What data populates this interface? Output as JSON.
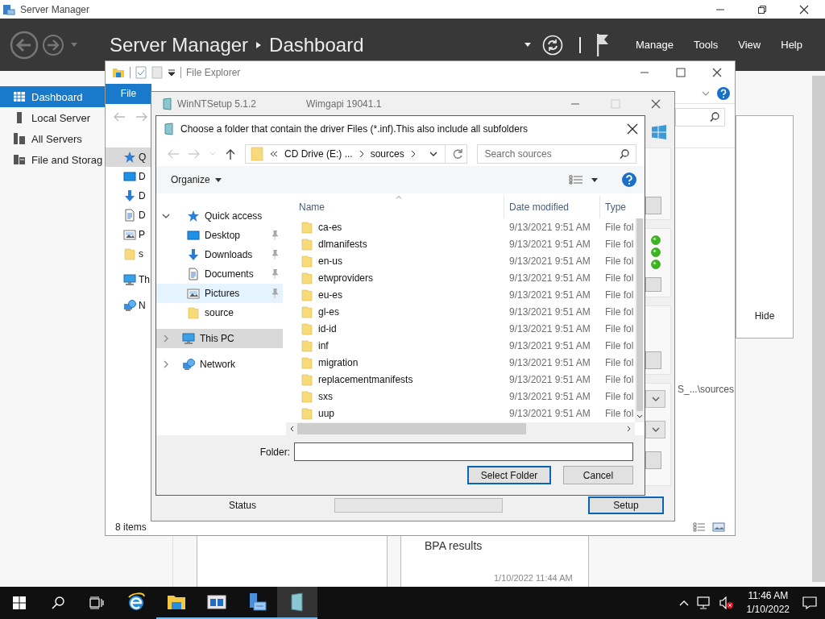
{
  "server_manager": {
    "title": "Server Manager",
    "breadcrumb": [
      "Server Manager",
      "Dashboard"
    ],
    "menu": [
      "Manage",
      "Tools",
      "View",
      "Help"
    ],
    "sidebar": [
      {
        "label": "Dashboard",
        "kind": "dashboard",
        "selected": true
      },
      {
        "label": "Local Server",
        "kind": "server",
        "selected": false
      },
      {
        "label": "All Servers",
        "kind": "servers",
        "selected": false
      },
      {
        "label": "File and Storag",
        "kind": "storage",
        "selected": false
      }
    ],
    "hide_label": "Hide",
    "tile_title": "BPA results",
    "timestamp": "1/10/2022 11:44 AM"
  },
  "file_explorer": {
    "title": "File Explorer",
    "ribbon_tab": "File",
    "nav_items": [
      {
        "label": "Q",
        "kind": "quick",
        "selected": true
      },
      {
        "label": "D",
        "kind": "desktop",
        "selected": false
      },
      {
        "label": "D",
        "kind": "downloads",
        "selected": false
      },
      {
        "label": "D",
        "kind": "documents",
        "selected": false
      },
      {
        "label": "P",
        "kind": "pictures",
        "selected": false
      },
      {
        "label": "s",
        "kind": "folder",
        "selected": false
      },
      {
        "label": "Th",
        "kind": "pc",
        "selected": false
      },
      {
        "label": "N",
        "kind": "network",
        "selected": false
      }
    ],
    "path": "S_...\\sources",
    "status": "8 items"
  },
  "winntsetup": {
    "title": "WinNTSetup 5.1.2",
    "version": "Wimgapi 19041.1",
    "status_label": "Status",
    "progress": {
      "level": 0
    },
    "setup_button": "Setup"
  },
  "folder_dialog": {
    "title": "Choose a folder that contain the driver Files (*.inf).This also include all subfolders",
    "address": [
      "CD Drive (E:) ...",
      "sources"
    ],
    "search_placeholder": "Search sources",
    "organize": "Organize",
    "nav": [
      {
        "label": "Quick access",
        "kind": "quick",
        "expanded": true,
        "selected": false,
        "hovered": false,
        "children": [
          {
            "label": "Desktop",
            "kind": "desktop",
            "pinned": true,
            "selected": false,
            "hovered": false
          },
          {
            "label": "Downloads",
            "kind": "downloads",
            "pinned": true,
            "selected": false,
            "hovered": false
          },
          {
            "label": "Documents",
            "kind": "documents",
            "pinned": true,
            "selected": false,
            "hovered": false
          },
          {
            "label": "Pictures",
            "kind": "pictures",
            "pinned": true,
            "selected": false,
            "hovered": true
          },
          {
            "label": "source",
            "kind": "folder",
            "pinned": false,
            "selected": false,
            "hovered": false
          }
        ]
      },
      {
        "label": "This PC",
        "kind": "pc",
        "expanded": false,
        "selected": true,
        "hovered": false
      },
      {
        "label": "Network",
        "kind": "network",
        "expanded": false,
        "selected": false,
        "hovered": false
      }
    ],
    "columns": [
      "Name",
      "Date modified",
      "Type"
    ],
    "rows": [
      {
        "name": "ca-es",
        "date": "9/13/2021 9:51 AM",
        "type": "File fol"
      },
      {
        "name": "dlmanifests",
        "date": "9/13/2021 9:51 AM",
        "type": "File fol"
      },
      {
        "name": "en-us",
        "date": "9/13/2021 9:51 AM",
        "type": "File fol"
      },
      {
        "name": "etwproviders",
        "date": "9/13/2021 9:51 AM",
        "type": "File fol"
      },
      {
        "name": "eu-es",
        "date": "9/13/2021 9:51 AM",
        "type": "File fol"
      },
      {
        "name": "gl-es",
        "date": "9/13/2021 9:51 AM",
        "type": "File fol"
      },
      {
        "name": "id-id",
        "date": "9/13/2021 9:51 AM",
        "type": "File fol"
      },
      {
        "name": "inf",
        "date": "9/13/2021 9:51 AM",
        "type": "File fol"
      },
      {
        "name": "migration",
        "date": "9/13/2021 9:51 AM",
        "type": "File fol"
      },
      {
        "name": "replacementmanifests",
        "date": "9/13/2021 9:51 AM",
        "type": "File fol"
      },
      {
        "name": "sxs",
        "date": "9/13/2021 9:51 AM",
        "type": "File fol"
      },
      {
        "name": "uup",
        "date": "9/13/2021 9:51 AM",
        "type": "File fol"
      }
    ],
    "folder_label": "Folder:",
    "buttons": [
      {
        "label": "Select Folder",
        "default": true
      },
      {
        "label": "Cancel",
        "default": false
      }
    ]
  },
  "taskbar": {
    "apps": [
      {
        "kind": "browser",
        "running": false,
        "selected": false
      },
      {
        "kind": "explorer",
        "running": true,
        "selected": false
      },
      {
        "kind": "window",
        "running": true,
        "selected": false
      },
      {
        "kind": "server",
        "running": true,
        "selected": false
      },
      {
        "kind": "setup",
        "running": true,
        "selected": true
      }
    ],
    "time": "11:46 AM",
    "date": "1/10/2022"
  }
}
